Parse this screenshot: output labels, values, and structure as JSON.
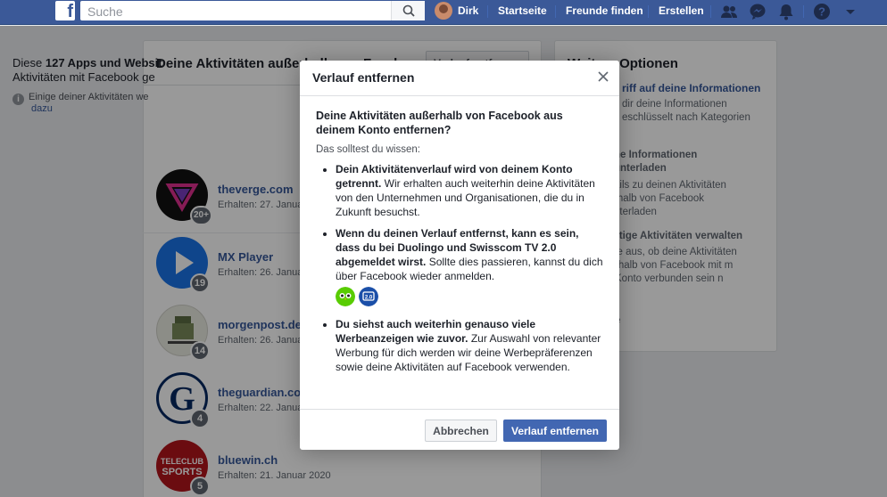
{
  "topbar": {
    "search_placeholder": "Suche",
    "user_name": "Dirk",
    "nav": [
      "Startseite",
      "Freunde finden",
      "Erstellen"
    ],
    "brand_color": "#3b5998"
  },
  "main": {
    "title": "Deine Aktivitäten außerhalb von Faceb",
    "header_button": "Verlauf entfernen",
    "intro_pre": "Diese ",
    "intro_bold": "127 Apps und Websit",
    "intro_line2": "Aktivitäten mit Facebook ge",
    "info_text": "Einige deiner Aktivitäten we",
    "info_link": "dazu",
    "rows": [
      {
        "name": "theverge.com",
        "meta": "Erhalten: 27. Januar",
        "badge": "20+"
      },
      {
        "name": "MX Player",
        "meta": "Erhalten: 26. Januar",
        "badge": "19"
      },
      {
        "name": "morgenpost.de",
        "meta": "Erhalten: 26. Januar",
        "badge": "14"
      },
      {
        "name": "theguardian.co",
        "meta": "Erhalten: 22. Januar",
        "badge": "4"
      },
      {
        "name": "bluewin.ch",
        "meta": "Erhalten: 21. Januar 2020",
        "badge": "5"
      }
    ]
  },
  "side": {
    "title": "Weitere Optionen",
    "s1_title": "riff auf deine Informationen",
    "s1_desc": "dir deine Informationen eschlüsselt nach Kategorien",
    "s2_title": "ne Informationen unterladen",
    "s2_desc": "ails zu deinen Aktivitäten rhalb von Facebook nterladen",
    "s3_title": "ftige Aktivitäten verwalten",
    "s3_desc": "le aus, ob deine Aktivitäten rhalb von Facebook mit m Konto verbunden sein n",
    "s4_title": "e"
  },
  "dialog": {
    "title": "Verlauf entfernen",
    "question": "Deine Aktivitäten außerhalb von Facebook aus deinem Konto entfernen?",
    "know": "Das solltest du wissen:",
    "p1_bold": "Dein Aktivitätenverlauf wird von deinem Konto getrennt.",
    "p1_text": " Wir erhalten auch weiterhin deine Aktivitäten von den Unternehmen und Organisationen, die du in Zukunft besuchst.",
    "p2_bold": "Wenn du deinen Verlauf entfernst, kann es sein, dass du bei Duolingo und Swisscom TV 2.0 abgemeldet wirst.",
    "p2_text": " Sollte dies passieren, kannst du dich über Facebook wieder anmelden.",
    "p3_bold": "Du siehst auch weiterhin genauso viele Werbeanzeigen wie zuvor.",
    "p3_text": " Zur Auswahl von relevanter Werbung für dich werden wir deine Werbepräferenzen sowie deine Aktivitäten auf Facebook verwenden.",
    "cancel": "Abbrechen",
    "confirm": "Verlauf entfernen",
    "app_icons": [
      "duolingo-icon",
      "swisscom-tv-icon"
    ]
  }
}
